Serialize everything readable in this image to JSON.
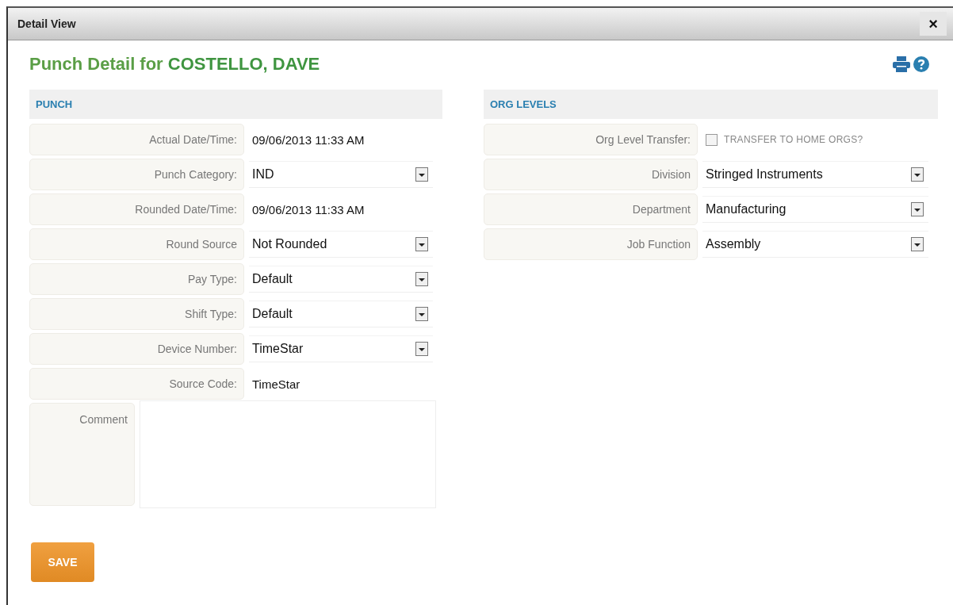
{
  "window": {
    "title": "Detail View",
    "close": "×"
  },
  "heading": "Punch Detail for **COSTELLO, DAVE**",
  "sections": [
    {
      "title": "PUNCH",
      "rows": [
        {
          "kind": "text",
          "label": "Actual Date/Time:",
          "value": "09/06/2013 11:33 AM"
        },
        {
          "kind": "select",
          "label": "Punch Category:",
          "value": "IND"
        },
        {
          "kind": "text",
          "label": "Rounded Date/Time:",
          "value": "09/06/2013 11:33 AM"
        },
        {
          "kind": "select",
          "label": "Round Source",
          "value": "Not Rounded"
        },
        {
          "kind": "select",
          "label": "Pay Type:",
          "value": "Default"
        },
        {
          "kind": "select",
          "label": "Shift Type:",
          "value": "Default"
        },
        {
          "kind": "select",
          "label": "Device Number:",
          "value": "TimeStar"
        },
        {
          "kind": "text",
          "label": "Source Code:",
          "value": "TimeStar"
        },
        {
          "kind": "textarea",
          "label": "Comment"
        }
      ]
    },
    {
      "title": "ORG LEVELS",
      "rows": [
        {
          "kind": "checkbox",
          "label": "Org Level Transfer:",
          "value": "TRANSFER TO HOME ORGS?",
          "checked": false
        },
        {
          "kind": "select",
          "label": "Division",
          "value": "Stringed Instruments"
        },
        {
          "kind": "select",
          "label": "Department",
          "value": "Manufacturing"
        },
        {
          "kind": "select",
          "label": "Job Function",
          "value": "Assembly"
        }
      ]
    }
  ],
  "save_button": "SAVE"
}
